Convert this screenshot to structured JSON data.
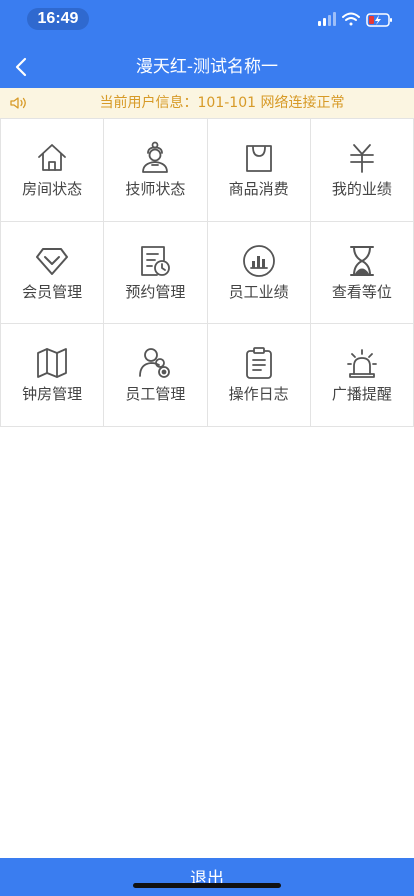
{
  "status_bar": {
    "time": "16:49"
  },
  "header": {
    "title": "漫天红-测试名称一"
  },
  "notice": {
    "text": "当前用户信息：101-101 网络连接正常"
  },
  "menu": [
    {
      "label": "房间状态",
      "icon": "home-icon"
    },
    {
      "label": "技师状态",
      "icon": "technician-icon"
    },
    {
      "label": "商品消费",
      "icon": "shopping-bag-icon"
    },
    {
      "label": "我的业绩",
      "icon": "yuan-icon"
    },
    {
      "label": "会员管理",
      "icon": "diamond-icon"
    },
    {
      "label": "预约管理",
      "icon": "schedule-icon"
    },
    {
      "label": "员工业绩",
      "icon": "chart-icon"
    },
    {
      "label": "查看等位",
      "icon": "hourglass-icon"
    },
    {
      "label": "钟房管理",
      "icon": "map-icon"
    },
    {
      "label": "员工管理",
      "icon": "staff-icon"
    },
    {
      "label": "操作日志",
      "icon": "clipboard-icon"
    },
    {
      "label": "广播提醒",
      "icon": "alarm-icon"
    }
  ],
  "footer": {
    "logout_label": "退出"
  },
  "colors": {
    "primary": "#3a7df0",
    "notice_text": "#d79a27",
    "notice_bg": "#fbf5e1",
    "icon": "#555555"
  }
}
